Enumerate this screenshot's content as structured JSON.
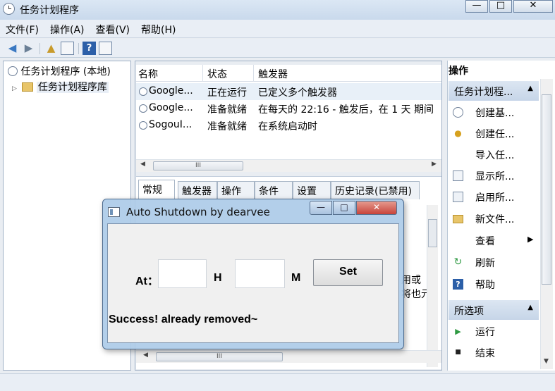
{
  "window": {
    "title": "任务计划程序",
    "minimize_glyph": "—",
    "maximize_glyph": "□",
    "close_glyph": "✕"
  },
  "menu": [
    "文件(F)",
    "操作(A)",
    "查看(V)",
    "帮助(H)"
  ],
  "toolbar": {
    "icons": [
      "back-arrow-icon",
      "forward-arrow-icon",
      "up-folder-icon",
      "show-hide-console-tree-icon",
      "help-icon",
      "show-hide-action-pane-icon"
    ],
    "help_glyph": "?"
  },
  "tree": {
    "root_label": "任务计划程序 (本地)",
    "child_label": "任务计划程序库"
  },
  "tasks": {
    "columns": [
      "名称",
      "状态",
      "触发器"
    ],
    "rows": [
      {
        "name": "Google...",
        "status": "正在运行",
        "trigger": "已定义多个触发器"
      },
      {
        "name": "Google...",
        "status": "准备就绪",
        "trigger": "在每天的 22:16 - 触发后，在 1 天 期间"
      },
      {
        "name": "SogouI...",
        "status": "准备就绪",
        "trigger": "在系统启动时"
      }
    ],
    "scroll_grip": "III"
  },
  "detail": {
    "tabs": [
      "常规",
      "触发器",
      "操作",
      "条件",
      "设置",
      "历史记录(已禁用)"
    ],
    "active_tab": "常规",
    "partial_text_1": "用或",
    "partial_text_2": "将也元",
    "scroll_grip": "III"
  },
  "actions": {
    "header": "操作",
    "group1": "任务计划程...",
    "group1_items": [
      {
        "icon": "connect-computer-icon",
        "label": "创建基..."
      },
      {
        "icon": "create-task-icon",
        "label": "创建任..."
      },
      {
        "icon": "import-task-icon",
        "label": "导入任..."
      },
      {
        "icon": "display-running-icon",
        "label": "显示所..."
      },
      {
        "icon": "enable-history-icon",
        "label": "启用所..."
      },
      {
        "icon": "new-folder-icon",
        "label": "新文件..."
      },
      {
        "icon": "view-icon",
        "label": "查看"
      },
      {
        "icon": "refresh-icon",
        "label": "刷新"
      },
      {
        "icon": "help-icon",
        "label": "帮助"
      }
    ],
    "group2": "所选项",
    "group2_items": [
      {
        "icon": "run-icon",
        "label": "运行"
      },
      {
        "icon": "end-icon",
        "label": "结束"
      }
    ]
  },
  "dialog": {
    "title": "Auto Shutdown by dearvee",
    "at_label": "At：",
    "hour_value": "",
    "hour_unit": "H",
    "minute_value": "",
    "minute_unit": "M",
    "set_label": "Set",
    "status_message": "Success! already removed~",
    "minimize_glyph": "—",
    "maximize_glyph": "□",
    "close_glyph": "✕"
  },
  "colors": {
    "accent": "#c6d5e8",
    "close_button": "#c8443b",
    "selection": "#e8f0f8"
  }
}
